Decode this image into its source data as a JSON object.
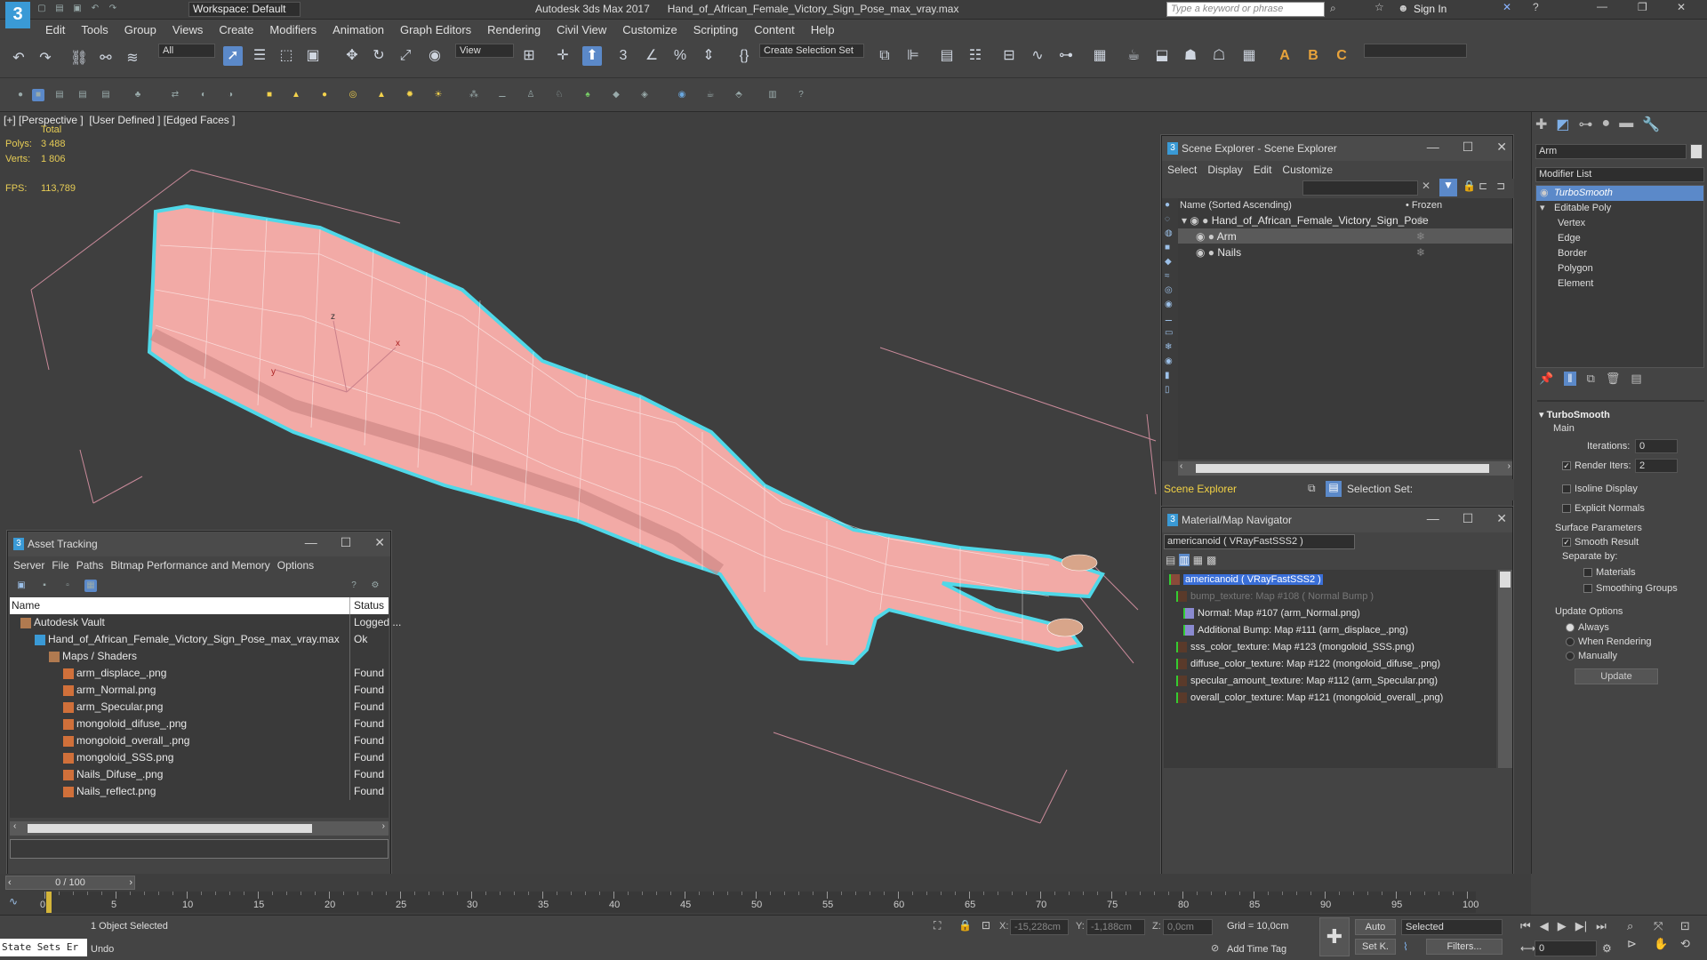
{
  "title_bar": {
    "workspace_label": "Workspace: Default",
    "title": "Autodesk 3ds Max 2017      Hand_of_African_Female_Victory_Sign_Pose_max_vray.max",
    "search_placeholder": "Type a keyword or phrase",
    "sign_in": "Sign In"
  },
  "menu": [
    "Edit",
    "Tools",
    "Group",
    "Views",
    "Create",
    "Modifiers",
    "Animation",
    "Graph Editors",
    "Rendering",
    "Civil View",
    "Customize",
    "Scripting",
    "Content",
    "Help"
  ],
  "main_toolbar": {
    "filter_dropdown": "All",
    "ref_coord_dropdown": "View",
    "selection_set_dropdown": "Create Selection Set"
  },
  "viewport": {
    "label": "[+] [Perspective ]  [User Defined ] [Edged Faces ]",
    "stats": {
      "total_label": "Total",
      "polys_label": "Polys:",
      "polys": "3 488",
      "verts_label": "Verts:",
      "verts": "1 806",
      "fps_label": "FPS:",
      "fps": "113,789"
    },
    "gizmo": {
      "x": "x",
      "y": "y",
      "z": "z"
    }
  },
  "scene_explorer": {
    "title": "Scene Explorer - Scene Explorer",
    "menu": [
      "Select",
      "Display",
      "Edit",
      "Customize"
    ],
    "col_name": "Name (Sorted Ascending)",
    "col_frozen": "• Frozen",
    "rows": [
      {
        "name": "Hand_of_African_Female_Victory_Sign_Pose",
        "level": 0
      },
      {
        "name": "Arm",
        "level": 1
      },
      {
        "name": "Nails",
        "level": 1
      }
    ],
    "footer_label": "Scene Explorer",
    "selection_set_label": "Selection Set:"
  },
  "material_navigator": {
    "title": "Material/Map Navigator",
    "field_value": "americanoid  ( VRayFastSSS2 )",
    "items": [
      {
        "text": "americanoid  ( VRayFastSSS2 )",
        "level": 0,
        "selected": true
      },
      {
        "text": "bump_texture: Map #108  ( Normal Bump )",
        "level": 1,
        "dim": true
      },
      {
        "text": "Normal: Map #107 (arm_Normal.png)",
        "level": 2
      },
      {
        "text": "Additional Bump: Map #111 (arm_displace_.png)",
        "level": 2
      },
      {
        "text": "sss_color_texture: Map #123 (mongoloid_SSS.png)",
        "level": 1
      },
      {
        "text": "diffuse_color_texture: Map #122 (mongoloid_difuse_.png)",
        "level": 1
      },
      {
        "text": "specular_amount_texture: Map #112 (arm_Specular.png)",
        "level": 1
      },
      {
        "text": "overall_color_texture: Map #121 (mongoloid_overall_.png)",
        "level": 1
      }
    ]
  },
  "asset_tracking": {
    "title": "Asset Tracking",
    "menu": [
      "Server",
      "File",
      "Paths",
      "Bitmap Performance and Memory",
      "Options"
    ],
    "col_name": "Name",
    "col_status": "Status",
    "rows": [
      {
        "name": "Autodesk Vault",
        "status": "Logged ...",
        "level": 0
      },
      {
        "name": "Hand_of_African_Female_Victory_Sign_Pose_max_vray.max",
        "status": "Ok",
        "level": 1
      },
      {
        "name": "Maps / Shaders",
        "status": "",
        "level": 2
      },
      {
        "name": "arm_displace_.png",
        "status": "Found",
        "level": 3
      },
      {
        "name": "arm_Normal.png",
        "status": "Found",
        "level": 3
      },
      {
        "name": "arm_Specular.png",
        "status": "Found",
        "level": 3
      },
      {
        "name": "mongoloid_difuse_.png",
        "status": "Found",
        "level": 3
      },
      {
        "name": "mongoloid_overall_.png",
        "status": "Found",
        "level": 3
      },
      {
        "name": "mongoloid_SSS.png",
        "status": "Found",
        "level": 3
      },
      {
        "name": "Nails_Difuse_.png",
        "status": "Found",
        "level": 3
      },
      {
        "name": "Nails_reflect.png",
        "status": "Found",
        "level": 3
      }
    ]
  },
  "command_panel": {
    "object_name": "Arm",
    "modifier_list_label": "Modifier List",
    "stack": [
      {
        "name": "TurboSmooth",
        "selected": true
      },
      {
        "name": "Editable Poly",
        "selected": false
      },
      {
        "name": "Vertex",
        "sub": true
      },
      {
        "name": "Edge",
        "sub": true
      },
      {
        "name": "Border",
        "sub": true
      },
      {
        "name": "Polygon",
        "sub": true
      },
      {
        "name": "Element",
        "sub": true
      }
    ],
    "turbosmooth": {
      "header": "TurboSmooth",
      "main_label": "Main",
      "iterations_label": "Iterations:",
      "iterations": "0",
      "render_iters_label": "Render Iters:",
      "render_iters": "2",
      "isoline": "Isoline Display",
      "explicit_normals": "Explicit Normals",
      "surface_params": "Surface Parameters",
      "smooth_result": "Smooth Result",
      "separate_by": "Separate by:",
      "materials": "Materials",
      "smoothing_groups": "Smoothing Groups",
      "update_options": "Update Options",
      "always": "Always",
      "when_rendering": "When Rendering",
      "manually": "Manually",
      "update_button": "Update"
    }
  },
  "timeline": {
    "frame_counter": "0 / 100",
    "ticks": [
      "0",
      "5",
      "10",
      "15",
      "20",
      "25",
      "30",
      "35",
      "40",
      "45",
      "50",
      "55",
      "60",
      "65",
      "70",
      "75",
      "80",
      "85",
      "90",
      "95",
      "100"
    ]
  },
  "status_bar": {
    "state_sets": "State Sets Er",
    "selected_text": "1 Object Selected",
    "undo_text": "Undo",
    "x_label": "X:",
    "x_value": "-15,228cm",
    "y_label": "Y:",
    "y_value": "-1,188cm",
    "z_label": "Z:",
    "z_value": "0,0cm",
    "grid": "Grid = 10,0cm",
    "add_time_tag": "Add Time Tag",
    "auto": "Auto",
    "set_k": "Set K.",
    "selected_dropdown": "Selected",
    "filters": "Filters...",
    "frame_field": "0"
  }
}
